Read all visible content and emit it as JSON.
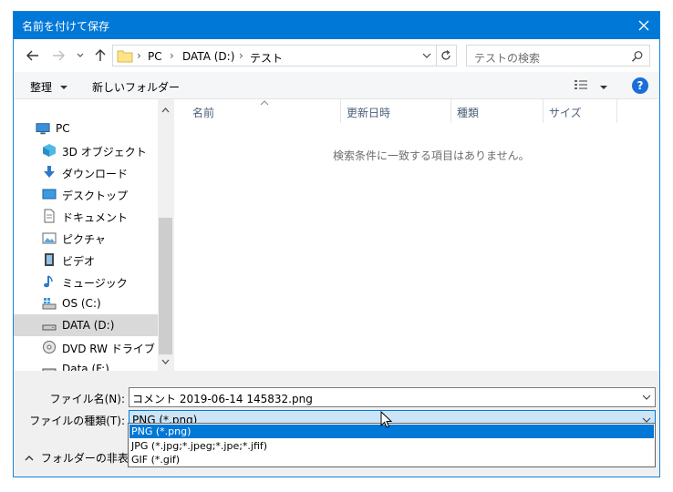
{
  "window": {
    "title": "名前を付けて保存"
  },
  "address": {
    "segments": [
      "PC",
      "DATA (D:)",
      "テスト"
    ]
  },
  "search": {
    "placeholder": "テストの検索"
  },
  "toolbar": {
    "organize_label": "整理",
    "new_folder_label": "新しいフォルダー"
  },
  "nav": {
    "items": [
      {
        "label": "PC",
        "icon": "pc-icon"
      },
      {
        "label": "3D オブジェクト",
        "icon": "3d-objects-icon"
      },
      {
        "label": "ダウンロード",
        "icon": "download-icon"
      },
      {
        "label": "デスクトップ",
        "icon": "desktop-icon"
      },
      {
        "label": "ドキュメント",
        "icon": "document-icon"
      },
      {
        "label": "ピクチャ",
        "icon": "pictures-icon"
      },
      {
        "label": "ビデオ",
        "icon": "video-icon"
      },
      {
        "label": "ミュージック",
        "icon": "music-icon"
      },
      {
        "label": "OS (C:)",
        "icon": "os-drive-icon"
      },
      {
        "label": "DATA (D:)",
        "icon": "drive-icon",
        "selected": true
      },
      {
        "label": "DVD RW ドライブ (E:)",
        "icon": "dvd-icon"
      },
      {
        "label": "Data (F:)",
        "icon": "drive-icon"
      }
    ]
  },
  "columns": [
    "名前",
    "更新日時",
    "種類",
    "サイズ"
  ],
  "empty_message": "検索条件に一致する項目はありません。",
  "filename": {
    "label": "ファイル名(N):",
    "value": "コメント 2019-06-14 145832.png"
  },
  "filetype": {
    "label": "ファイルの種類(T):",
    "value": "PNG (*.png)",
    "options": [
      "PNG (*.png)",
      "JPG (*.jpg;*.jpeg;*.jpe;*.jfif)",
      "GIF (*.gif)"
    ]
  },
  "hide_folders_label": "フォルダーの非表示",
  "colors": {
    "accent": "#0078d7",
    "selection": "#cce4f7"
  }
}
